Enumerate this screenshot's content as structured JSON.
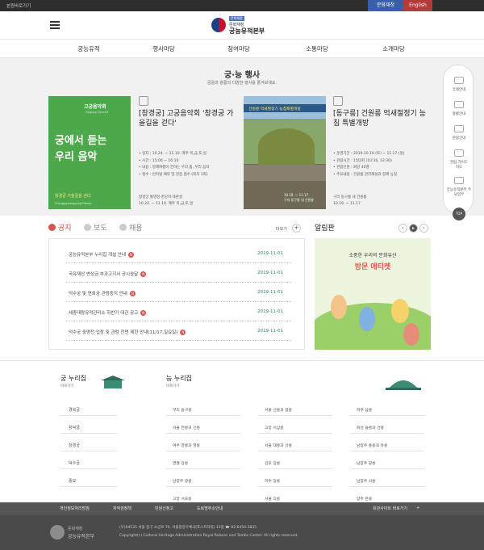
{
  "topbar": {
    "home_link": "본원바로가기",
    "lang_ko": "문화재청",
    "lang_en": "English"
  },
  "header": {
    "logo_tag": "문화재청",
    "logo_sub": "문화재청",
    "logo_main": "궁능유적본부"
  },
  "gnb": [
    "궁능유적",
    "행사마당",
    "참여마당",
    "소통마당",
    "소개마당"
  ],
  "events": {
    "title": "궁·능 행사",
    "subtitle": "궁궐과 왕릉의 다양한 행사를 즐겨보세요.",
    "event1": {
      "poster_top": "고궁음악회",
      "poster_en": "Gogung Concert",
      "poster_line1": "궁에서 듣는",
      "poster_line2": "우리 음악",
      "poster_bottom": "창경궁 가을길을 걷다",
      "poster_bottom2": "Changgyeonggung Palace",
      "name": "[창경궁] 고궁음악회 '창경궁 가을길을 걷다'",
      "detail1": "• 일자 : 10.24. ~ 11.10. 매주 목,금,토,일",
      "detail2": "• 시간 : 15:00 ~ 16:10",
      "detail3": "• 내용 : 정재여행이 전하는 우리 춤, 우리 음악",
      "detail4": "• 접수 : 인터넷 예약 및 현장 접수 (회차 1회)",
      "place": "창경궁 통명전·춘당지·대온실",
      "date": "10.24. ~ 11.10. 매주 목,금,토,일"
    },
    "event2": {
      "poster_title": "건원릉 억새절정기 능침특별개방",
      "poster_note1": "10.19. ~ 11.17.",
      "poster_note2": "구리 동구릉 내 건원릉",
      "name": "[동구릉] 건원릉 억새절정기 능침 특별개방",
      "detail1": "• 운영기간 : 2019.10.19.(토) ~ 11.17.(일)",
      "detail2": "• 관람시간 : 1일2회 (10:30, 13:30)",
      "detail3": "• 관람인원 : 회당 40명",
      "detail4": "• 주요내용 : 건원릉 관리해설과 함께 능침",
      "place": "구리 동구릉 내 건원릉",
      "date": "10.19. ~ 11.17."
    }
  },
  "quick_menu": [
    "궁궐안내",
    "왕릉안내",
    "관람안내",
    "관람 가이드 지도",
    "궁능유적본부 주요업무"
  ],
  "quick_top": "TOP",
  "notice": {
    "tabs": [
      "공지",
      "보도",
      "채용"
    ],
    "more": "더보기",
    "items": [
      {
        "title": "궁능유적본부 누리집 개설 안내",
        "date": "2019-11-01"
      },
      {
        "title": "국유재산 변상금 부과고지서 공시송달",
        "date": "2019-11-01"
      },
      {
        "title": "덕수궁 및 연호궁 관람중지 안내",
        "date": "2019-11-01"
      },
      {
        "title": "세종대왕유적관리소 하반기 대관 공고",
        "date": "2019-11-01"
      },
      {
        "title": "덕수궁 중명전 입장 및 관람 전면 제한 안내(11/17,일요일)",
        "date": "2019-11-01"
      }
    ]
  },
  "alarm": {
    "title": "알림판",
    "banner_line1": "소중한 우리의 문화유산",
    "banner_line2": "방문 에티켓"
  },
  "family": {
    "palace_title": "궁 누리집",
    "palace_sub": "바로가기",
    "palaces": [
      "경복궁",
      "창덕궁",
      "창경궁",
      "덕수궁",
      "종묘"
    ],
    "tomb_title": "능 누리집",
    "tomb_sub": "바로가기",
    "tombs": [
      "구리 동구릉",
      "서울 선릉과 정릉",
      "파주 삼릉",
      "서울 헌릉과 인릉",
      "고양 서삼릉",
      "화성 융릉과 건릉",
      "여주 영릉과 영릉",
      "서울 태릉과 강릉",
      "남양주 홍릉과 유릉",
      "영월 장릉",
      "김포 장릉",
      "남양주 광릉",
      "남양주 광릉",
      "파주 장릉",
      "남양주 사릉",
      "고양 서오릉",
      "서울 의릉",
      "양주 온릉"
    ]
  },
  "footer_links": [
    "개인정보처리방침",
    "저작권정책",
    "민원신청고",
    "도로명주소안내"
  ],
  "footer_family_site": "유관사이트 바로가기",
  "footer": {
    "logo_line1": "문화재청",
    "logo_line2": "궁능유적본부",
    "address": "(우)04535 서울 중구 소공로 70, 서울중앙우체국(포스트타워) 15층   ☎ 02-6450-3835",
    "copyright": "Copyright(c) Cultural Heritage Administration Royal Palaces and Tombs Center. All rights reserved."
  }
}
